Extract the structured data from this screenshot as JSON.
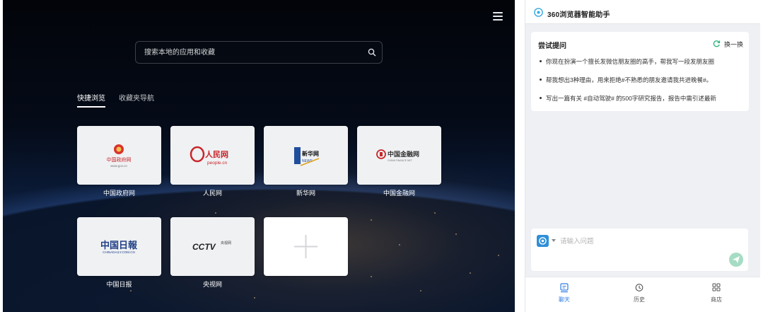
{
  "newtab": {
    "search": {
      "placeholder": "搜索本地的应用和收藏"
    },
    "tabs": [
      {
        "label": "快捷浏览",
        "active": true
      },
      {
        "label": "收藏夹导航",
        "active": false
      }
    ],
    "tiles": [
      {
        "label": "中国政府网",
        "logo_text": "中国政府网",
        "logo_sub": "www.gov.cn"
      },
      {
        "label": "人民网",
        "logo_text": "人民网",
        "logo_sub": "people.cn"
      },
      {
        "label": "新华网",
        "logo_text": "新华网",
        "logo_sub": "NEWS"
      },
      {
        "label": "中国金融网",
        "logo_text": "中国金融网",
        "logo_sub": "CHINA FINANCE NET"
      },
      {
        "label": "中国日报",
        "logo_text": "中国日報",
        "logo_sub": "CHINADAILY.COM.CN"
      },
      {
        "label": "央视网",
        "logo_text": "CCTV",
        "logo_sub": "央视网"
      }
    ]
  },
  "assistant": {
    "title": "360浏览器智能助手",
    "suggestions": {
      "title": "尝试提问",
      "refresh_label": "换一换",
      "items": [
        "你现在扮演一个擅长发微信朋友圈的高手，帮我写一段发朋友圈",
        "帮我想出3种理由，用来拒绝#不熟悉的朋友邀请我共进晚餐#。",
        "写出一篇有关 #自动驾驶# 的500字研究报告，报告中需引述最新"
      ]
    },
    "input": {
      "placeholder": "请输入问题"
    },
    "nav": [
      {
        "label": "聊天",
        "icon": "chat-icon",
        "active": true
      },
      {
        "label": "历史",
        "icon": "history-icon",
        "active": false
      },
      {
        "label": "商店",
        "icon": "store-icon",
        "active": false
      }
    ]
  },
  "colors": {
    "accent_blue": "#2d7be0",
    "send_green": "#a6dcc4",
    "tile_bg": "#f0f1f3"
  }
}
